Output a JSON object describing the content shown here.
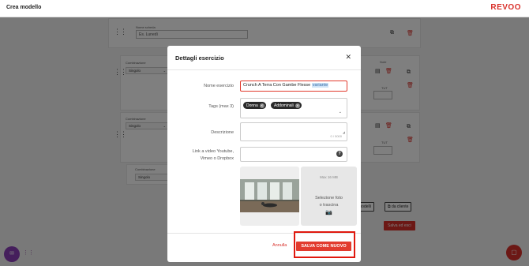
{
  "header": {
    "title": "Crea modello",
    "logo": "REVOO"
  },
  "background": {
    "scheda_label": "Nome scheda",
    "scheda_placeholder": "Es. Lunedì",
    "combinazione_label": "Combinazione",
    "singolo": "Singolo",
    "note_label": "Note",
    "tut_label": "TUT",
    "modelli_button": "modelli",
    "cliente_button": "da cliente",
    "save_exit_button": "Salva ed esci"
  },
  "modal": {
    "title": "Dettagli esercizio",
    "fields": {
      "nome_label": "Nome esercizio",
      "nome_value": "Crunch A Terra Con Gambe Flesse",
      "nome_highlight": "variante",
      "tags_label": "Tags (max 3)",
      "tags": [
        "Donna",
        "Addominali"
      ],
      "descrizione_label": "Descrizione",
      "descrizione_counter": "0 / 5000",
      "video_label_line1": "Link a video Youtube,",
      "video_label_line2": "Vimeo o Dropbox"
    },
    "upload": {
      "max_size": "Max 16 MB",
      "drop_line1": "Selezione foto",
      "drop_line2": "o trascina"
    },
    "cancel_label": "Annulla",
    "save_new_label": "SALVA COME NUOVO"
  },
  "colors": {
    "accent": "#d9302a",
    "chat": "#8a3fb8"
  },
  "icons": [
    "drag-handle-icon",
    "copy-icon",
    "trash-icon",
    "close-icon",
    "chevron-down-icon",
    "help-icon",
    "camera-icon",
    "chat-icon",
    "file-icon"
  ]
}
